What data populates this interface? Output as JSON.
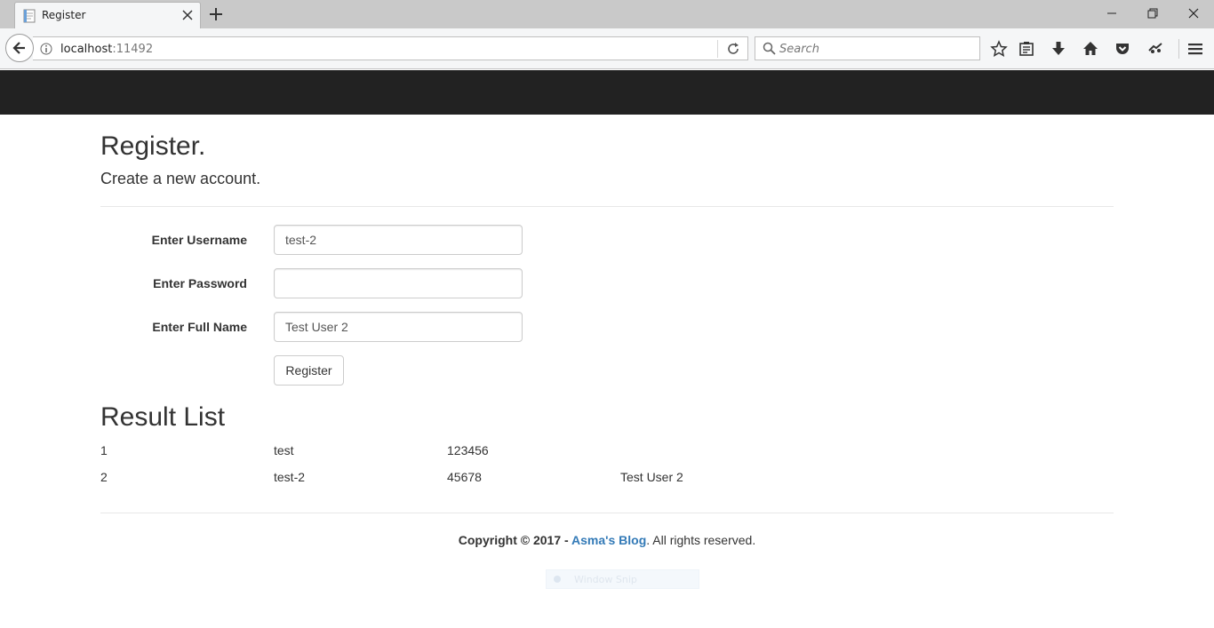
{
  "browser": {
    "tab_title": "Register",
    "url_host": "localhost",
    "url_port": ":11492",
    "search_placeholder": "Search"
  },
  "page": {
    "title": "Register.",
    "subtitle": "Create a new account."
  },
  "form": {
    "username_label": "Enter Username",
    "username_value": "test-2",
    "password_label": "Enter Password",
    "password_value": "",
    "fullname_label": "Enter Full Name",
    "fullname_value": "Test User 2",
    "register_label": "Register"
  },
  "results": {
    "title": "Result List",
    "rows": [
      {
        "id": "1",
        "username": "test",
        "password": "123456",
        "fullname": ""
      },
      {
        "id": "2",
        "username": "test-2",
        "password": "45678",
        "fullname": "Test User 2"
      }
    ]
  },
  "footer": {
    "prefix": "Copyright © 2017 - ",
    "link": "Asma's Blog",
    "suffix": ". All rights reserved."
  },
  "overlay": {
    "snip_label": "Window Snip"
  }
}
